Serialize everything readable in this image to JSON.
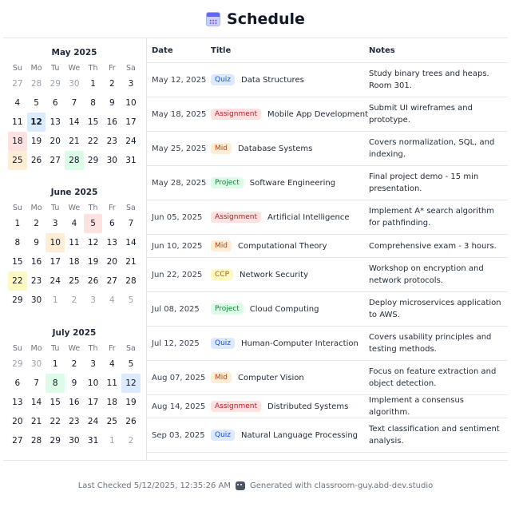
{
  "header": {
    "title": "Schedule",
    "icon": "calendar-icon"
  },
  "weekdays": [
    "Su",
    "Mo",
    "Tu",
    "We",
    "Th",
    "Fr",
    "Sa"
  ],
  "colors": {
    "quiz": {
      "bg": "#dbeafe",
      "fg": "#1d4ed8"
    },
    "assignment": {
      "bg": "#fee2e2",
      "fg": "#b91c1c"
    },
    "mid": {
      "bg": "#ffedd5",
      "fg": "#c2410c"
    },
    "project": {
      "bg": "#dcfce7",
      "fg": "#15803d"
    },
    "ccp": {
      "bg": "#fef9c3",
      "fg": "#a16207"
    }
  },
  "calendars": [
    {
      "title": "May 2025",
      "days": [
        {
          "d": "27",
          "muted": true
        },
        {
          "d": "28",
          "muted": true
        },
        {
          "d": "29",
          "muted": true
        },
        {
          "d": "30",
          "muted": true
        },
        {
          "d": "1"
        },
        {
          "d": "2"
        },
        {
          "d": "3"
        },
        {
          "d": "4"
        },
        {
          "d": "5"
        },
        {
          "d": "6"
        },
        {
          "d": "7"
        },
        {
          "d": "8"
        },
        {
          "d": "9"
        },
        {
          "d": "10"
        },
        {
          "d": "11"
        },
        {
          "d": "12",
          "hl": "quiz",
          "today": true
        },
        {
          "d": "13"
        },
        {
          "d": "14"
        },
        {
          "d": "15"
        },
        {
          "d": "16"
        },
        {
          "d": "17"
        },
        {
          "d": "18",
          "hl": "assignment"
        },
        {
          "d": "19"
        },
        {
          "d": "20"
        },
        {
          "d": "21"
        },
        {
          "d": "22"
        },
        {
          "d": "23"
        },
        {
          "d": "24"
        },
        {
          "d": "25",
          "hl": "mid"
        },
        {
          "d": "26"
        },
        {
          "d": "27"
        },
        {
          "d": "28",
          "hl": "project"
        },
        {
          "d": "29"
        },
        {
          "d": "30"
        },
        {
          "d": "31"
        }
      ]
    },
    {
      "title": "June 2025",
      "days": [
        {
          "d": "1"
        },
        {
          "d": "2"
        },
        {
          "d": "3"
        },
        {
          "d": "4"
        },
        {
          "d": "5",
          "hl": "assignment"
        },
        {
          "d": "6"
        },
        {
          "d": "7"
        },
        {
          "d": "8"
        },
        {
          "d": "9"
        },
        {
          "d": "10",
          "hl": "mid"
        },
        {
          "d": "11"
        },
        {
          "d": "12"
        },
        {
          "d": "13"
        },
        {
          "d": "14"
        },
        {
          "d": "15"
        },
        {
          "d": "16"
        },
        {
          "d": "17"
        },
        {
          "d": "18"
        },
        {
          "d": "19"
        },
        {
          "d": "20"
        },
        {
          "d": "21"
        },
        {
          "d": "22",
          "hl": "ccp"
        },
        {
          "d": "23"
        },
        {
          "d": "24"
        },
        {
          "d": "25"
        },
        {
          "d": "26"
        },
        {
          "d": "27"
        },
        {
          "d": "28"
        },
        {
          "d": "29"
        },
        {
          "d": "30"
        },
        {
          "d": "1",
          "muted": true
        },
        {
          "d": "2",
          "muted": true
        },
        {
          "d": "3",
          "muted": true
        },
        {
          "d": "4",
          "muted": true
        },
        {
          "d": "5",
          "muted": true
        }
      ]
    },
    {
      "title": "July 2025",
      "days": [
        {
          "d": "29",
          "muted": true
        },
        {
          "d": "30",
          "muted": true
        },
        {
          "d": "1"
        },
        {
          "d": "2"
        },
        {
          "d": "3"
        },
        {
          "d": "4"
        },
        {
          "d": "5"
        },
        {
          "d": "6"
        },
        {
          "d": "7"
        },
        {
          "d": "8",
          "hl": "project"
        },
        {
          "d": "9"
        },
        {
          "d": "10"
        },
        {
          "d": "11"
        },
        {
          "d": "12",
          "hl": "quiz"
        },
        {
          "d": "13"
        },
        {
          "d": "14"
        },
        {
          "d": "15"
        },
        {
          "d": "16"
        },
        {
          "d": "17"
        },
        {
          "d": "18"
        },
        {
          "d": "19"
        },
        {
          "d": "20"
        },
        {
          "d": "21"
        },
        {
          "d": "22"
        },
        {
          "d": "23"
        },
        {
          "d": "24"
        },
        {
          "d": "25"
        },
        {
          "d": "26"
        },
        {
          "d": "27"
        },
        {
          "d": "28"
        },
        {
          "d": "29"
        },
        {
          "d": "30"
        },
        {
          "d": "31"
        },
        {
          "d": "1",
          "muted": true
        },
        {
          "d": "2",
          "muted": true
        }
      ]
    }
  ],
  "table": {
    "headers": {
      "date": "Date",
      "title": "Title",
      "notes": "Notes"
    },
    "rows": [
      {
        "date": "May 12, 2025",
        "type": "Quiz",
        "kind": "quiz",
        "title": "Data Structures",
        "notes": "Study binary trees and heaps. Room 301."
      },
      {
        "date": "May 18, 2025",
        "type": "Assignment",
        "kind": "assignment",
        "title": "Mobile App Development",
        "notes": "Submit UI wireframes and prototype."
      },
      {
        "date": "May 25, 2025",
        "type": "Mid",
        "kind": "mid",
        "title": "Database Systems",
        "notes": "Covers normalization, SQL, and indexing."
      },
      {
        "date": "May 28, 2025",
        "type": "Project",
        "kind": "project",
        "title": "Software Engineering",
        "notes": "Final project demo - 15 min presentation."
      },
      {
        "date": "Jun 05, 2025",
        "type": "Assignment",
        "kind": "assignment",
        "title": "Artificial Intelligence",
        "notes": "Implement A* search algorithm for pathfinding."
      },
      {
        "date": "Jun 10, 2025",
        "type": "Mid",
        "kind": "mid",
        "title": "Computational Theory",
        "notes": "Comprehensive exam - 3 hours."
      },
      {
        "date": "Jun 22, 2025",
        "type": "CCP",
        "kind": "ccp",
        "title": "Network Security",
        "notes": "Workshop on encryption and network protocols."
      },
      {
        "date": "Jul 08, 2025",
        "type": "Project",
        "kind": "project",
        "title": "Cloud Computing",
        "notes": "Deploy microservices application to AWS."
      },
      {
        "date": "Jul 12, 2025",
        "type": "Quiz",
        "kind": "quiz",
        "title": "Human-Computer Interaction",
        "notes": "Covers usability principles and testing methods."
      },
      {
        "date": "Aug 07, 2025",
        "type": "Mid",
        "kind": "mid",
        "title": "Computer Vision",
        "notes": "Focus on feature extraction and object detection."
      },
      {
        "date": "Aug 14, 2025",
        "type": "Assignment",
        "kind": "assignment",
        "title": "Distributed Systems",
        "notes": "Implement a consensus algorithm."
      },
      {
        "date": "Sep 03, 2025",
        "type": "Quiz",
        "kind": "quiz",
        "title": "Natural Language Processing",
        "notes": "Text classification and sentiment analysis."
      }
    ]
  },
  "footer": {
    "last_checked": "Last Checked 5/12/2025, 12:35:26 AM",
    "generated": "Generated with classroom-guy.abd-dev.studio",
    "icon": "robot-icon"
  }
}
